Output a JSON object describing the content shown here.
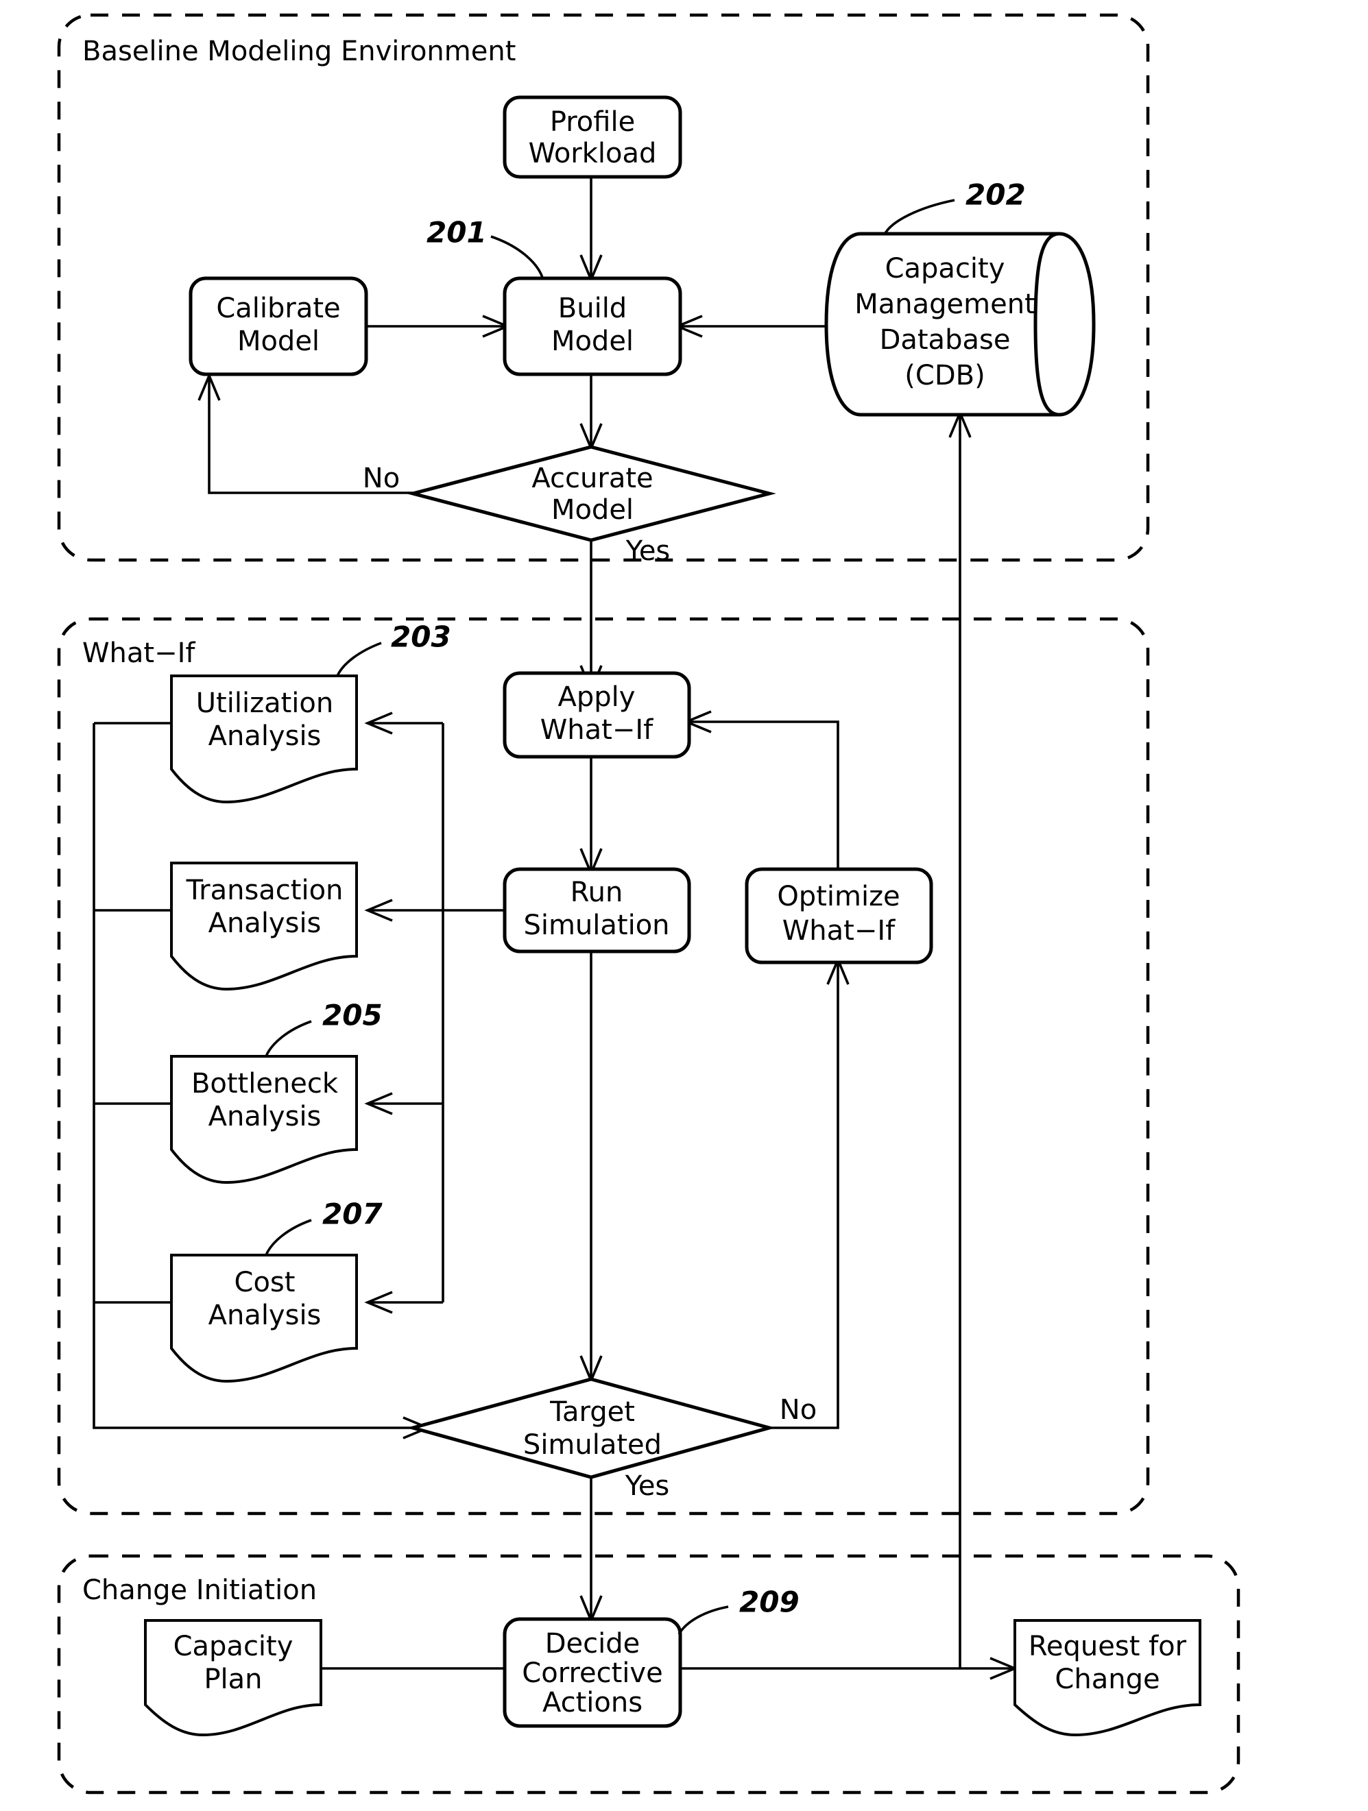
{
  "figure": {
    "type": "patent-flowchart",
    "title": "Capacity Management Process Flowchart"
  },
  "groups": [
    {
      "id": "baseline",
      "label": "Baseline Modeling Environment"
    },
    {
      "id": "whatif",
      "label": "What−If"
    },
    {
      "id": "change",
      "label": "Change Initiation"
    }
  ],
  "nodes": [
    {
      "id": "profile_workload",
      "label_line1": "Profile",
      "label_line2": "Workload",
      "shape": "rounded-rect"
    },
    {
      "id": "calibrate_model",
      "label_line1": "Calibrate",
      "label_line2": "Model",
      "shape": "rounded-rect"
    },
    {
      "id": "build_model",
      "label_line1": "Build",
      "label_line2": "Model",
      "shape": "rounded-rect"
    },
    {
      "id": "cdb",
      "label_line1": "Capacity",
      "label_line2": "Management",
      "label_line3": "Database",
      "label_line4": "(CDB)",
      "shape": "cylinder"
    },
    {
      "id": "accurate_model",
      "label_line1": "Accurate",
      "label_line2": "Model",
      "shape": "diamond"
    },
    {
      "id": "utilization_analysis",
      "label_line1": "Utilization",
      "label_line2": "Analysis",
      "shape": "document"
    },
    {
      "id": "transaction_analysis",
      "label_line1": "Transaction",
      "label_line2": "Analysis",
      "shape": "document"
    },
    {
      "id": "bottleneck_analysis",
      "label_line1": "Bottleneck",
      "label_line2": "Analysis",
      "shape": "document"
    },
    {
      "id": "cost_analysis",
      "label_line1": "Cost",
      "label_line2": "Analysis",
      "shape": "document"
    },
    {
      "id": "apply_whatif",
      "label_line1": "Apply",
      "label_line2": "What−If",
      "shape": "rounded-rect"
    },
    {
      "id": "run_simulation",
      "label_line1": "Run",
      "label_line2": "Simulation",
      "shape": "rounded-rect"
    },
    {
      "id": "optimize_whatif",
      "label_line1": "Optimize",
      "label_line2": "What−If",
      "shape": "rounded-rect"
    },
    {
      "id": "target_simulated",
      "label_line1": "Target",
      "label_line2": "Simulated",
      "shape": "diamond"
    },
    {
      "id": "decide_corrective",
      "label_line1": "Decide",
      "label_line2": "Corrective",
      "label_line3": "Actions",
      "shape": "rounded-rect"
    },
    {
      "id": "capacity_plan",
      "label_line1": "Capacity",
      "label_line2": "Plan",
      "shape": "document"
    },
    {
      "id": "request_for_change",
      "label_line1": "Request for",
      "label_line2": "Change",
      "shape": "document"
    }
  ],
  "reference_numerals": [
    {
      "id": "ref201",
      "value": "201",
      "points_to": "build_model"
    },
    {
      "id": "ref202",
      "value": "202",
      "points_to": "cdb"
    },
    {
      "id": "ref203",
      "value": "203",
      "points_to": "utilization_analysis"
    },
    {
      "id": "ref205",
      "value": "205",
      "points_to": "bottleneck_analysis"
    },
    {
      "id": "ref207",
      "value": "207",
      "points_to": "cost_analysis"
    },
    {
      "id": "ref209",
      "value": "209",
      "points_to": "decide_corrective"
    }
  ],
  "edge_labels": [
    {
      "id": "accurate_no",
      "text": "No",
      "edge": "accurate_model->calibrate_model"
    },
    {
      "id": "accurate_yes",
      "text": "Yes",
      "edge": "accurate_model->apply_whatif"
    },
    {
      "id": "target_no",
      "text": "No",
      "edge": "target_simulated->optimize_whatif"
    },
    {
      "id": "target_yes",
      "text": "Yes",
      "edge": "target_simulated->decide_corrective"
    }
  ],
  "colors": {
    "stroke": "#000000",
    "fill": "#ffffff",
    "background": "#ffffff"
  }
}
